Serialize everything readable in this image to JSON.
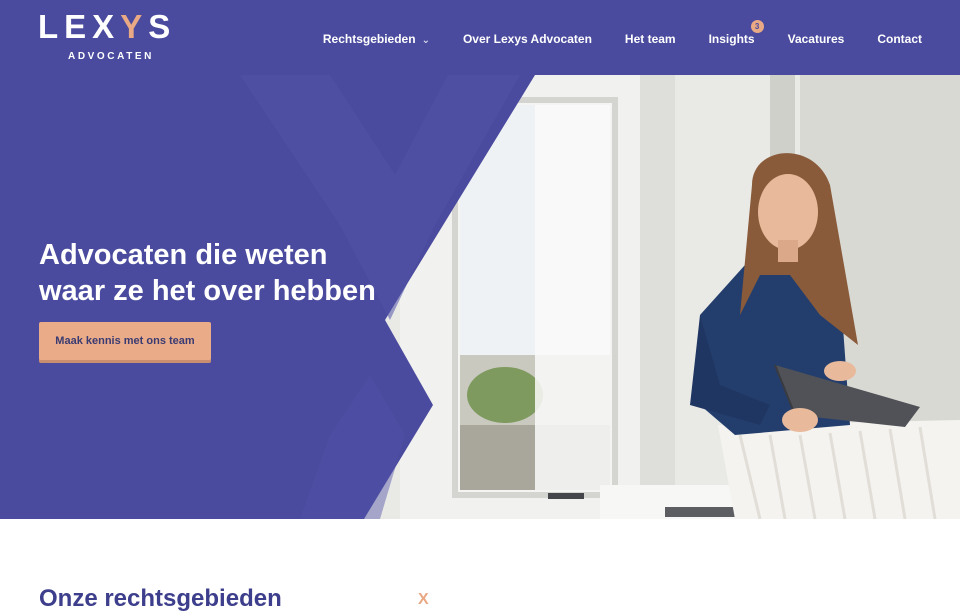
{
  "logo": {
    "word_main": "LEX",
    "word_accent": "Y",
    "word_end": "S",
    "sub": "ADVOCATEN"
  },
  "nav": {
    "items": [
      {
        "label": "Rechtsgebieden"
      },
      {
        "label": "Over Lexys Advocaten"
      },
      {
        "label": "Het team"
      },
      {
        "label": "Insights",
        "badge": "3"
      },
      {
        "label": "Vacatures"
      },
      {
        "label": "Contact"
      }
    ]
  },
  "hero": {
    "title": "Advocaten die weten waar ze het over hebben",
    "button_label": "Maak kennis met ons team"
  },
  "section": {
    "title": "Onze rechtsgebieden",
    "mark": "X"
  },
  "colors": {
    "brand": "#4a4b9e",
    "accent": "#e9a985",
    "text_dark": "#3d3e8c"
  }
}
